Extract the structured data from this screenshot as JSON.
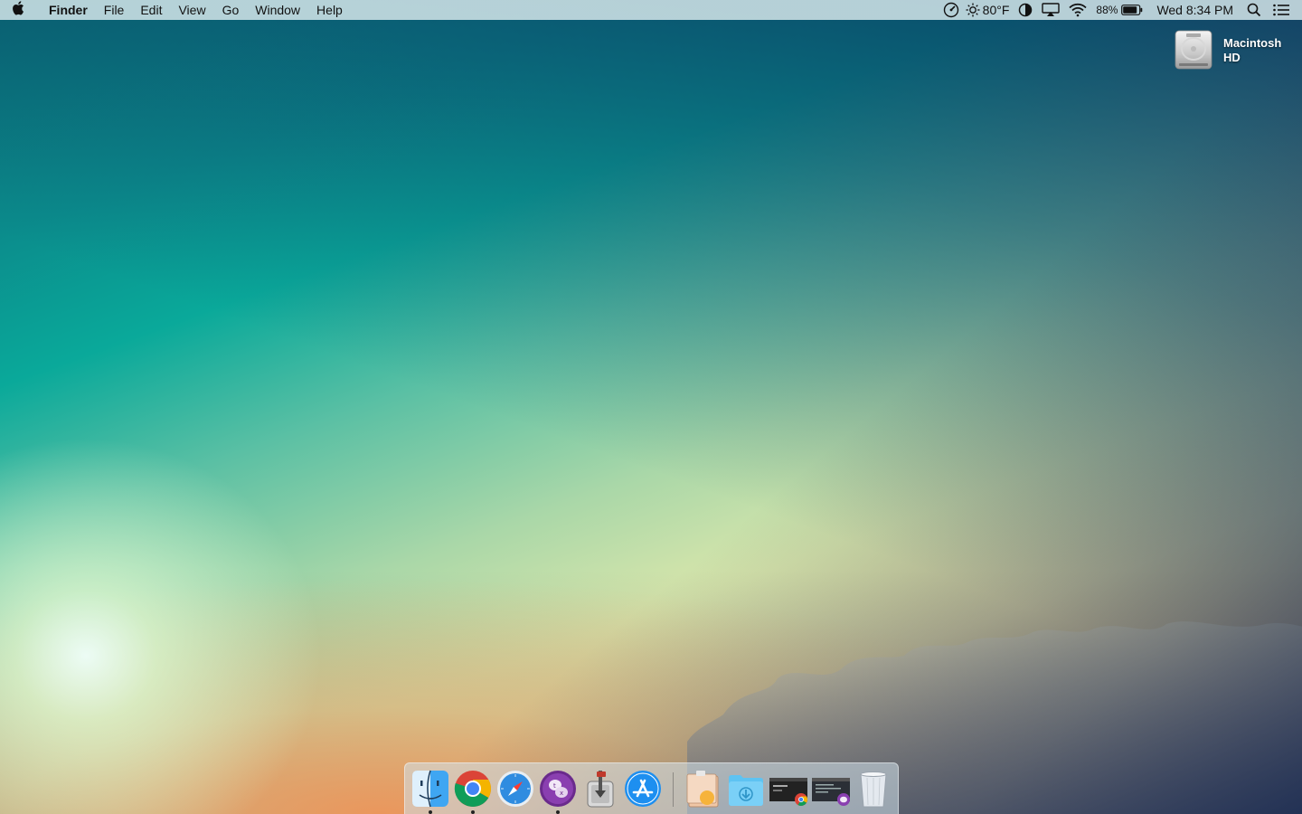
{
  "menubar": {
    "apple_icon": "apple-logo-icon",
    "app_name": "Finder",
    "menus": [
      "File",
      "Edit",
      "View",
      "Go",
      "Window",
      "Help"
    ],
    "status": {
      "speedometer_icon": "gauge-icon",
      "weather_icon": "sun-icon",
      "temperature": "80°F",
      "contrast_icon": "half-circle-icon",
      "airplay_icon": "airplay-icon",
      "wifi_icon": "wifi-icon",
      "battery_percent": "88%",
      "battery_level": 0.88,
      "battery_icon": "battery-icon",
      "clock": "Wed 8:34 PM",
      "spotlight_icon": "search-icon",
      "notifications_icon": "list-icon"
    }
  },
  "desktop": {
    "drive": {
      "label_line1": "Macintosh",
      "label_line2": "HD",
      "icon": "hard-drive-icon"
    }
  },
  "dock": {
    "apps": [
      {
        "name": "Finder",
        "icon": "finder-icon",
        "running": true
      },
      {
        "name": "Google Chrome",
        "icon": "chrome-icon",
        "running": true
      },
      {
        "name": "Safari",
        "icon": "safari-icon",
        "running": false
      },
      {
        "name": "Tor / Chat",
        "icon": "purple-chat-icon",
        "running": true
      },
      {
        "name": "Transmit",
        "icon": "transmit-icon",
        "running": false
      },
      {
        "name": "App Store",
        "icon": "app-store-icon",
        "running": false
      }
    ],
    "others": [
      {
        "name": "Preview stack",
        "icon": "stack-icon"
      },
      {
        "name": "Downloads",
        "icon": "downloads-folder-icon"
      },
      {
        "name": "Chrome window",
        "icon": "window-thumbnail-chrome-icon"
      },
      {
        "name": "Terminal window",
        "icon": "window-thumbnail-terminal-icon"
      },
      {
        "name": "Trash",
        "icon": "trash-icon"
      }
    ]
  },
  "colors": {
    "menubar_bg": "#dcebee",
    "sky_top": "#0a4f7a",
    "sky_mid": "#0aa99a",
    "horizon": "#f1c88e"
  }
}
